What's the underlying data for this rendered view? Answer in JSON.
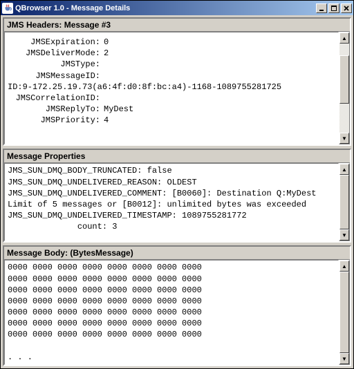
{
  "window": {
    "title": "QBrowser 1.0 - Message Details"
  },
  "panels": {
    "headers": {
      "title": "JMS Headers: Message #3",
      "rows": [
        {
          "key": "JMSExpiration:",
          "val": "0"
        },
        {
          "key": "JMSDeliverMode:",
          "val": "2"
        },
        {
          "key": "JMSType:",
          "val": ""
        },
        {
          "key": "JMSMessageID:",
          "val": ""
        }
      ],
      "messageIdLine": "ID:9-172.25.19.73(a6:4f:d0:8f:bc:a4)-1168-1089755281725",
      "rows2": [
        {
          "key": "JMSCorrelationID:",
          "val": ""
        },
        {
          "key": "JMSReplyTo:",
          "val": "MyDest"
        },
        {
          "key": "JMSPriority:",
          "val": "4"
        }
      ]
    },
    "properties": {
      "title": "Message Properties",
      "text": "JMS_SUN_DMQ_BODY_TRUNCATED: false\nJMS_SUN_DMQ_UNDELIVERED_REASON: OLDEST\nJMS_SUN_DMQ_UNDELIVERED_COMMENT: [B0060]: Destination Q:MyDest Limit of 5 messages or [B0012]: unlimited bytes was exceeded\nJMS_SUN_DMQ_UNDELIVERED_TIMESTAMP: 1089755281772\n              count: 3"
    },
    "body": {
      "title": "Message Body: (BytesMessage)",
      "text": "0000 0000 0000 0000 0000 0000 0000 0000\n0000 0000 0000 0000 0000 0000 0000 0000\n0000 0000 0000 0000 0000 0000 0000 0000\n0000 0000 0000 0000 0000 0000 0000 0000\n0000 0000 0000 0000 0000 0000 0000 0000\n0000 0000 0000 0000 0000 0000 0000 0000\n0000 0000 0000 0000 0000 0000 0000 0000\n\n. . ."
    }
  }
}
